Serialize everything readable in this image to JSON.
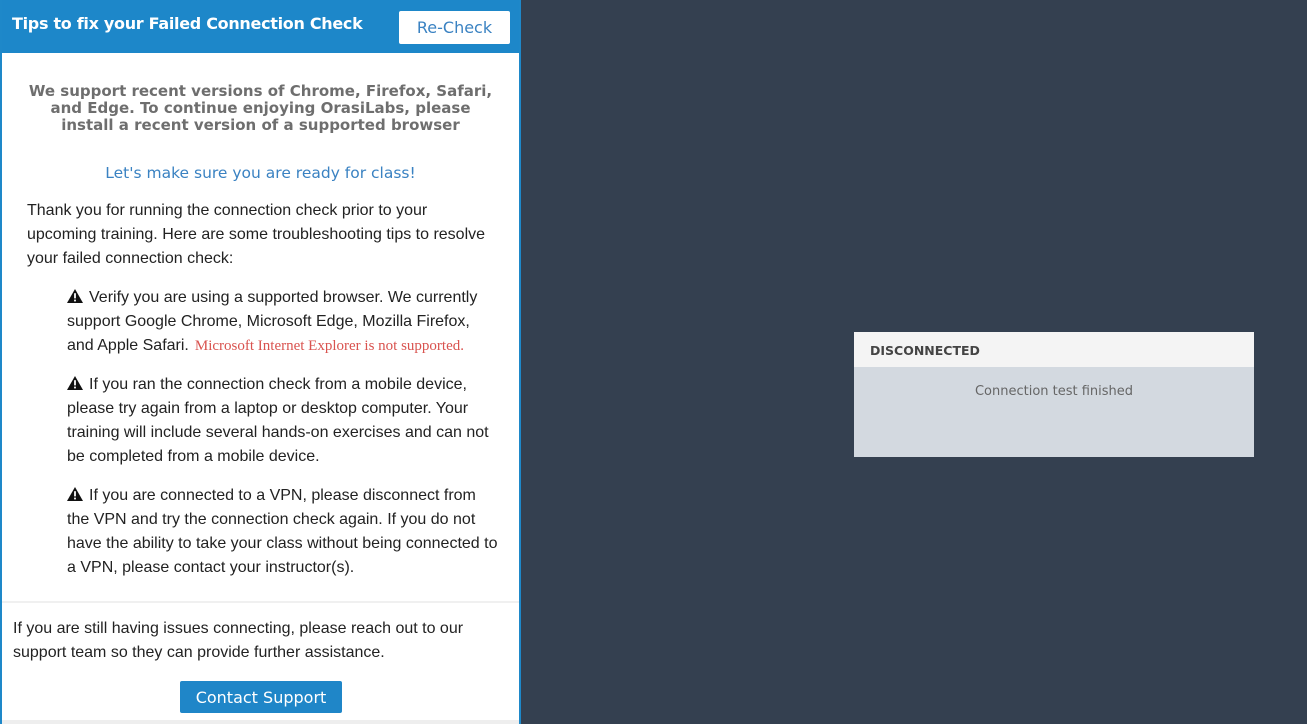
{
  "panel": {
    "title": "Tips to fix your Failed Connection Check",
    "recheck_label": "Re-Check",
    "browser_notice": "We support recent versions of Chrome, Firefox, Safari, and Edge. To continue enjoying OrasiLabs, please install a recent version of a supported browser",
    "ready_line": "Let's make sure you are ready for class!",
    "intro": "Thank you for running the connection check prior to your upcoming training. Here are some troubleshooting tips to resolve your failed connection check:",
    "tips": [
      {
        "icon": "warning-icon",
        "text": "Verify you are using a supported browser. We currently support Google Chrome, Microsoft Edge, Mozilla Firefox, and Apple Safari.",
        "note": "Microsoft Internet Explorer is not supported."
      },
      {
        "icon": "warning-icon",
        "text": "If you ran the connection check from a mobile device, please try again from a laptop or desktop computer. Your training will include several hands-on exercises and can not be completed from a mobile device."
      },
      {
        "icon": "warning-icon",
        "text": "If you are connected to a VPN, please disconnect from the VPN and try the connection check again. If you do not have the ability to take your class without being connected to a VPN, please contact your instructor(s)."
      }
    ],
    "footer_text": "If you are still having issues connecting, please reach out to our support team so they can provide further assistance.",
    "contact_label": "Contact Support"
  },
  "status": {
    "title": "DISCONNECTED",
    "message": "Connection test finished"
  },
  "colors": {
    "header_blue": "#1d87c9",
    "link_blue": "#3a82c2",
    "background": "#344050",
    "note_red": "#d9534f",
    "card_bg": "#d3d9e0"
  }
}
